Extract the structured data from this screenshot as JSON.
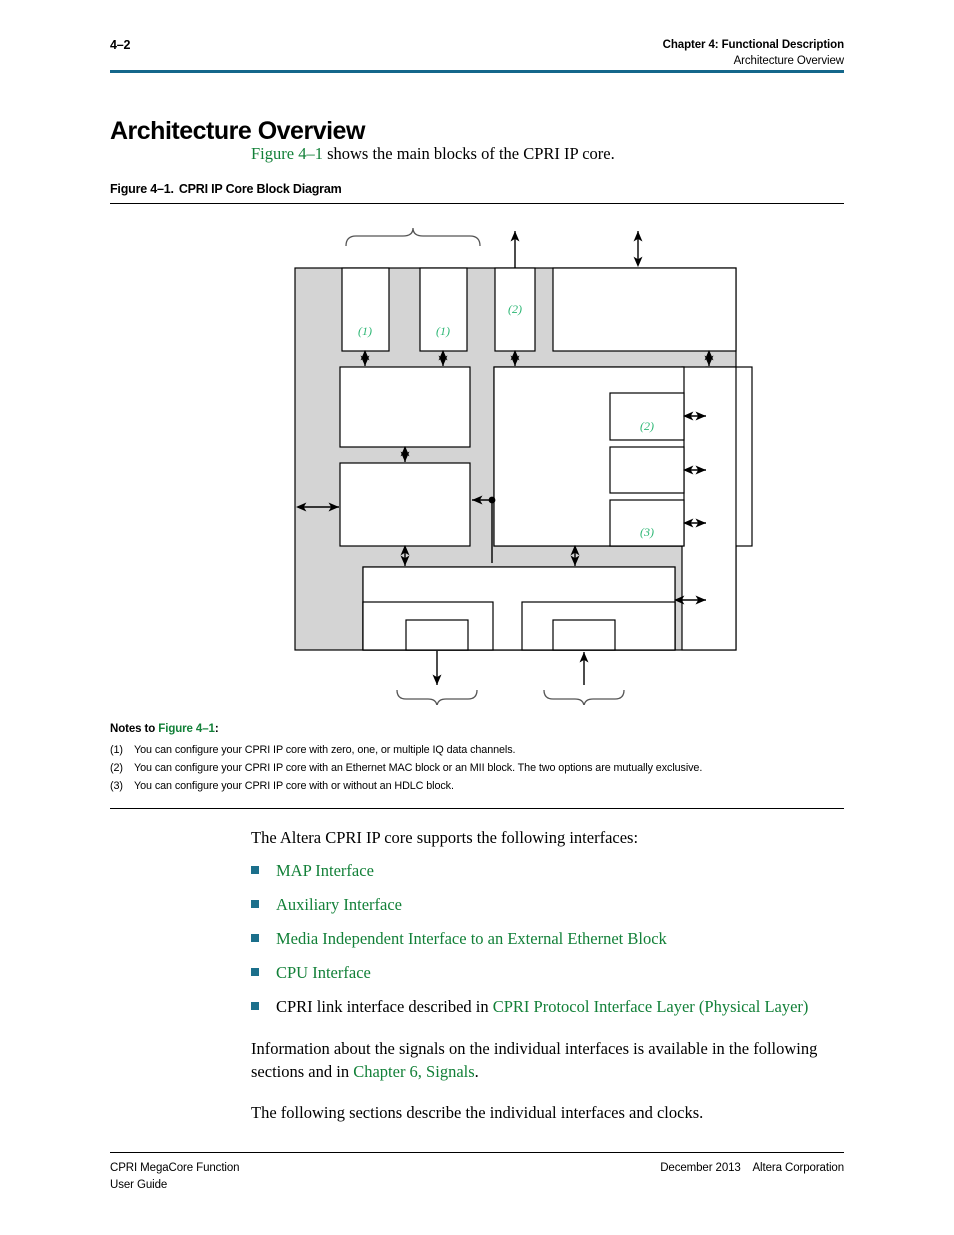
{
  "header": {
    "folio": "4–2",
    "chapter": "Chapter 4:  Functional Description",
    "section": "Architecture Overview",
    "rule_color": "#14678b"
  },
  "title": "Architecture Overview",
  "intro": {
    "link": "Figure 4–1",
    "rest": " shows the main blocks of the CPRI IP core."
  },
  "figure": {
    "caption_number": "Figure 4–1.",
    "caption_title": "CPRI IP Core Block Diagram",
    "callouts": [
      "(1)",
      "(1)",
      "(2)",
      "(2)",
      "(3)"
    ],
    "callout_color": "#2bb673",
    "fill_color": "#d4d4d4",
    "stroke_color": "#000000"
  },
  "notes": {
    "title_prefix": "Notes to ",
    "title_link": "Figure 4–1",
    "title_suffix": ":",
    "items": [
      {
        "marker": "(1)",
        "text": "You can configure your CPRI IP core with zero, one, or multiple IQ data channels."
      },
      {
        "marker": "(2)",
        "text": "You can configure your CPRI IP core with an Ethernet MAC block or an MII block. The two options are mutually exclusive."
      },
      {
        "marker": "(3)",
        "text": "You can configure your CPRI IP core with or without an HDLC block."
      }
    ]
  },
  "body": {
    "intro_line": "The Altera CPRI IP core supports the following interfaces:",
    "bullets": [
      {
        "pre": "",
        "link": "MAP Interface",
        "post": ""
      },
      {
        "pre": "",
        "link": "Auxiliary Interface",
        "post": ""
      },
      {
        "pre": "",
        "link": "Media Independent Interface to an External Ethernet Block",
        "post": ""
      },
      {
        "pre": "",
        "link": "CPU Interface",
        "post": ""
      },
      {
        "pre": "CPRI link interface described in ",
        "link": "CPRI Protocol Interface Layer (Physical Layer)",
        "post": ""
      }
    ],
    "para_signals_pre": "Information about the signals on the individual interfaces is available in the following sections and in ",
    "para_signals_link": "Chapter 6, Signals",
    "para_signals_post": ".",
    "para_closing": "The following sections describe the individual interfaces and clocks."
  },
  "footer": {
    "left_line1": "CPRI MegaCore Function",
    "left_line2": "User Guide",
    "right": "December 2013    Altera Corporation"
  }
}
